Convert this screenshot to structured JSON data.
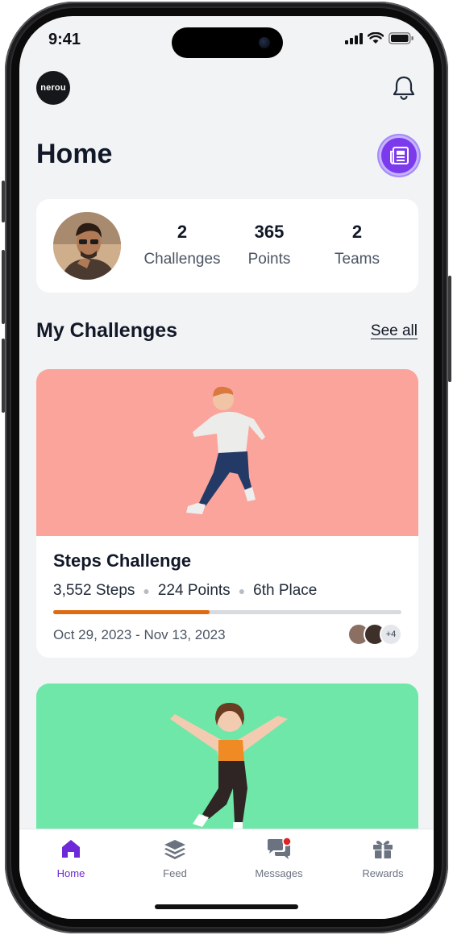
{
  "status_bar": {
    "time": "9:41"
  },
  "header": {
    "logo_text": "nerou",
    "title": "Home"
  },
  "stats": [
    {
      "value": "2",
      "label": "Challenges"
    },
    {
      "value": "365",
      "label": "Points"
    },
    {
      "value": "2",
      "label": "Teams"
    }
  ],
  "section": {
    "title": "My Challenges",
    "see_all": "See all"
  },
  "challenges": [
    {
      "title": "Steps Challenge",
      "steps": "3,552 Steps",
      "points": "224 Points",
      "place": "6th Place",
      "progress_fraction": 0.45,
      "dates": "Oct 29, 2023 - Nov 13, 2023",
      "participants_more": "+4",
      "image_color": "#fba49b",
      "progress_color": "#e06a10"
    },
    {
      "image_color": "#6ee7a8"
    }
  ],
  "tabs": [
    {
      "label": "Home",
      "icon": "home-icon",
      "active": true
    },
    {
      "label": "Feed",
      "icon": "layers-icon",
      "active": false
    },
    {
      "label": "Messages",
      "icon": "chat-icon",
      "active": false
    },
    {
      "label": "Rewards",
      "icon": "gift-icon",
      "active": false
    }
  ],
  "colors": {
    "accent": "#6d28d9",
    "background": "#f2f3f5"
  }
}
